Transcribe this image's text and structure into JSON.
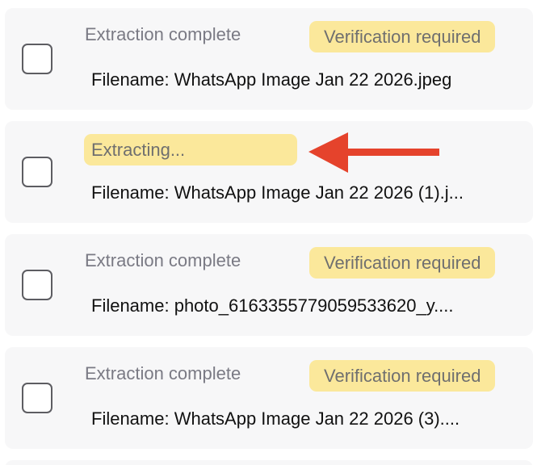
{
  "items": [
    {
      "status": "Extraction complete",
      "badge": "Verification required",
      "filename": "Filename: WhatsApp Image Jan 22 2026.jpeg"
    },
    {
      "status": "Extracting...",
      "filename": "Filename: WhatsApp Image Jan 22 2026 (1).j..."
    },
    {
      "status": "Extraction complete",
      "badge": "Verification required",
      "filename": "Filename: photo_6163355779059533620_y...."
    },
    {
      "status": "Extraction complete",
      "badge": "Verification required",
      "filename": "Filename: WhatsApp Image Jan 22 2026 (3)...."
    }
  ],
  "colors": {
    "badge_background": "#fbe89b",
    "card_background": "#f7f7f8",
    "annotation_arrow": "#e5432c"
  },
  "icons": {
    "annotation": "arrow-left-icon"
  }
}
